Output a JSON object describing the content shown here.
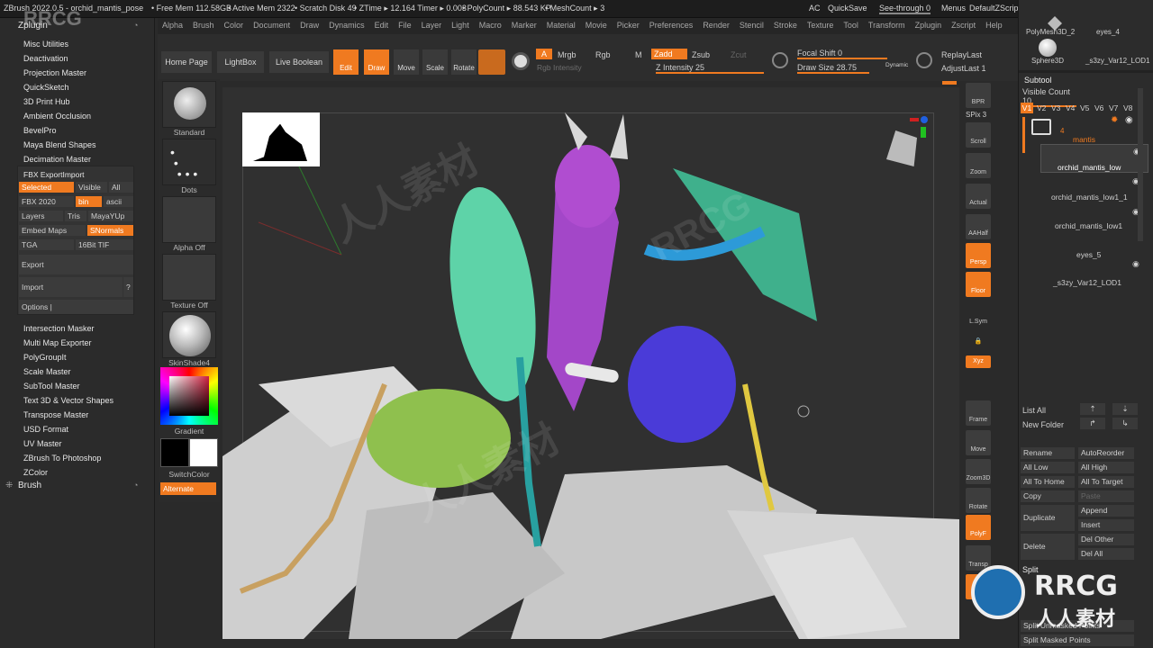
{
  "title_bar": {
    "app_title": "ZBrush 2022.0.5 - orchid_mantis_pose",
    "free_mem": "• Free Mem 112.58GB",
    "active_mem": "• Active Mem 2322",
    "scratch_disk": "• Scratch Disk 49",
    "ztime": "• ZTime ▸ 12.164 Timer ▸ 0.003",
    "polycount": "• PolyCount ▸ 88.543 KP",
    "meshcount": "• MeshCount ▸ 3",
    "ac": "AC",
    "quicksave": "QuickSave",
    "see_through": "See-through  0",
    "menus": "Menus",
    "default_zscript": "DefaultZScript"
  },
  "menu_bar": [
    "Alpha",
    "Brush",
    "Color",
    "Document",
    "Draw",
    "Dynamics",
    "Edit",
    "File",
    "Layer",
    "Light",
    "Macro",
    "Marker",
    "Material",
    "Movie",
    "Picker",
    "Preferences",
    "Render",
    "Stencil",
    "Stroke",
    "Texture",
    "Tool",
    "Transform",
    "Zplugin",
    "Zscript",
    "Help"
  ],
  "left_panel": {
    "header": "Zplugin",
    "items_top": [
      "Misc Utilities",
      "Deactivation",
      "Projection Master",
      "QuickSketch",
      "3D Print Hub",
      "Ambient Occlusion",
      "BevelPro",
      "Maya Blend Shapes",
      "Decimation Master"
    ],
    "fbx_title": "FBX ExportImport",
    "fbx": {
      "selected": "Selected",
      "visible": "Visible",
      "all": "All",
      "fbx2020": "FBX 2020",
      "bin": "bin",
      "ascii": "ascii",
      "layers": "Layers",
      "tris": "Tris",
      "mayayup": "MayaYUp",
      "embed_maps": "Embed Maps",
      "snormals": "SNormals",
      "tga": "TGA",
      "tif": "16Bit TIF",
      "export": "Export",
      "import": "Import",
      "q": "?",
      "options": "Options |"
    },
    "items_bottom": [
      "Intersection Masker",
      "Multi Map Exporter",
      "PolyGroupIt",
      "Scale Master",
      "SubTool Master",
      "Text 3D & Vector Shapes",
      "Transpose Master",
      "USD Format",
      "UV Master",
      "ZBrush To Photoshop",
      "ZColor"
    ],
    "brush_header": "Brush"
  },
  "toolbar": {
    "home_page": "Home Page",
    "lightbox": "LightBox",
    "live_boolean": "Live Boolean",
    "edit": "Edit",
    "draw": "Draw",
    "move": "Move",
    "scale": "Scale",
    "rotate": "Rotate",
    "a": "A",
    "mrgb": "Mrgb",
    "rgb": "Rgb",
    "m": "M",
    "rgb_intensity": "Rgb Intensity",
    "zadd": "Zadd",
    "zsub": "Zsub",
    "zcut": "Zcut",
    "z_intensity": "Z Intensity 25",
    "focal_shift": "Focal Shift 0",
    "draw_size": "Draw Size 28.75",
    "dynamic": "Dynamic",
    "replay_last": "ReplayLast",
    "adjust_last": "AdjustLast  1"
  },
  "shelf": {
    "standard": "Standard",
    "dots": "Dots",
    "alpha_off": "Alpha Off",
    "texture_off": "Texture Off",
    "skinshade": "SkinShade4",
    "gradient": "Gradient",
    "switch_color": "SwitchColor",
    "alternate": "Alternate"
  },
  "right_shelf": [
    "BPR",
    "SPix 3",
    "Scroll",
    "Zoom",
    "Actual",
    "AAHalf",
    "Persp",
    "Floor",
    "L.Sym",
    "",
    "Xyz",
    "",
    "Frame",
    "Move",
    "Zoom3D",
    "Rotate",
    "PolyF",
    "Transp",
    ""
  ],
  "right_panel": {
    "tool_thumbs": [
      "PolyMesh3D_2",
      "eyes_4",
      "Sphere3D",
      "_s3zy_Var12_LOD1"
    ],
    "subtool_header": "Subtool",
    "visible_count": "Visible Count 10",
    "versions": [
      "V1",
      "V2",
      "V3",
      "V4",
      "V5",
      "V6",
      "V7",
      "V8"
    ],
    "folder_count": "4",
    "subtools": [
      "mantis",
      "orchid_mantis_low",
      "orchid_mantis_low1_1",
      "orchid_mantis_low1",
      "eyes_5",
      "_s3zy_Var12_LOD1"
    ],
    "list_all": "List All",
    "new_folder": "New Folder",
    "rename": "Rename",
    "autoreorder": "AutoReorder",
    "all_low": "All Low",
    "all_high": "All High",
    "all_to_home": "All To Home",
    "all_to_target": "All To Target",
    "copy": "Copy",
    "paste": "Paste",
    "duplicate": "Duplicate",
    "append": "Append",
    "insert": "Insert",
    "delete": "Delete",
    "del_other": "Del Other",
    "del_all": "Del All",
    "split_header": "Split",
    "split_unmasked": "Split Unmasked Points",
    "split_masked": "Split Masked Points"
  },
  "watermarks": {
    "rrcg": "RRCG",
    "cn": "人人素材"
  },
  "colors": {
    "accent": "#f07a20",
    "bg": "#2a2a2a",
    "canvas": "#303030"
  }
}
